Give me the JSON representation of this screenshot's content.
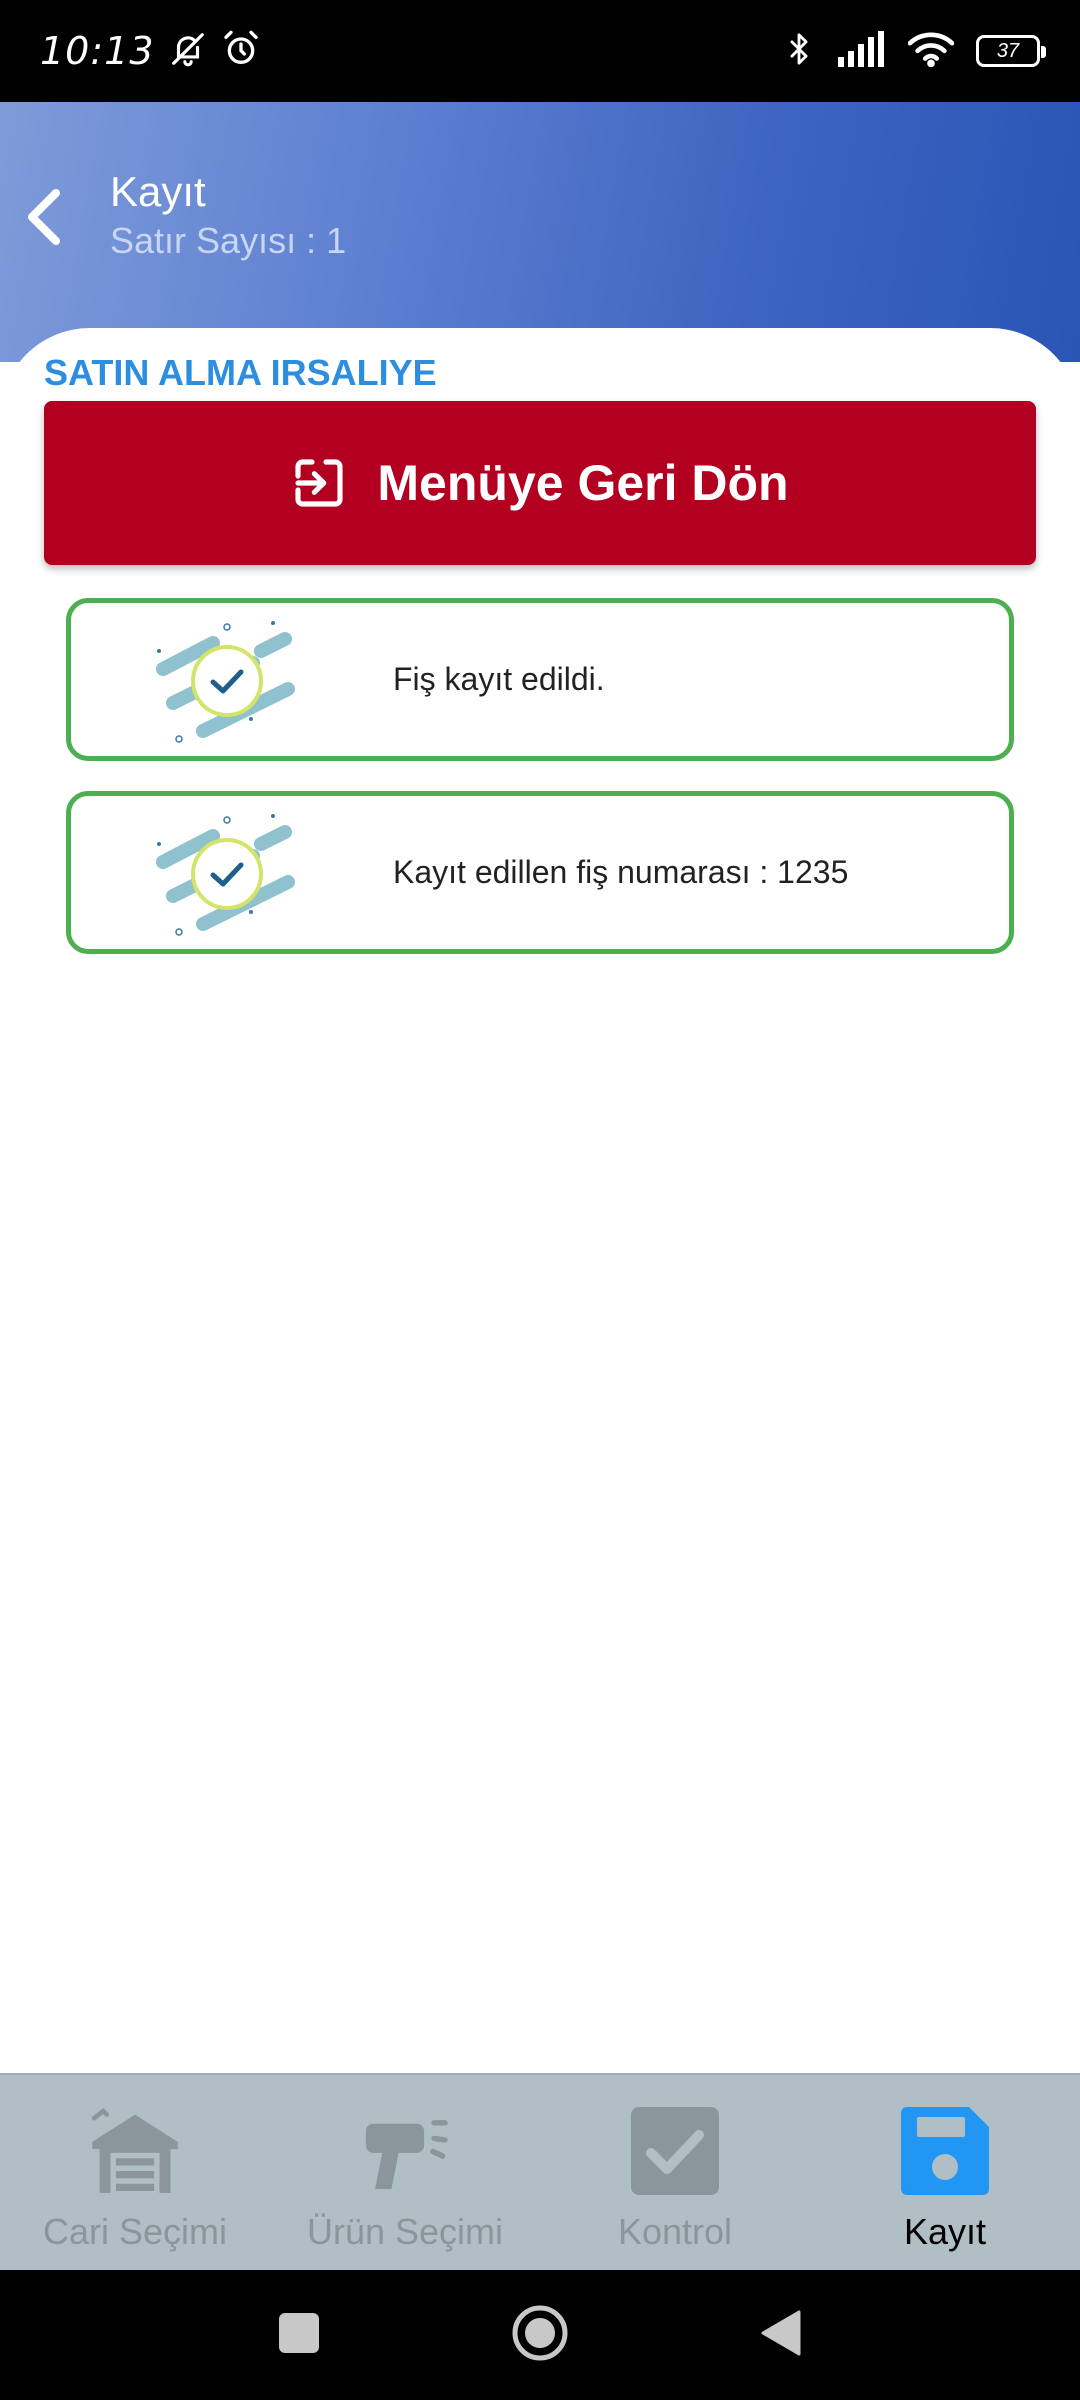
{
  "status_bar": {
    "time": "10:13",
    "battery": "37",
    "icons": [
      "bell-off-icon",
      "alarm-icon",
      "bluetooth-icon",
      "signal-icon",
      "wifi-icon",
      "battery-icon"
    ]
  },
  "header": {
    "title": "Kayıt",
    "subtitle": "Satır Sayısı : 1"
  },
  "section_title": "SATIN ALMA IRSALIYE",
  "menu_button_label": "Menüye Geri Dön",
  "messages": [
    {
      "text": "Fiş kayıt edildi."
    },
    {
      "text": "Kayıt edillen fiş numarası : 1235"
    }
  ],
  "bottom_nav": [
    {
      "label": "Cari Seçimi",
      "icon": "warehouse-icon",
      "active": false
    },
    {
      "label": "Ürün Seçimi",
      "icon": "barcode-scanner-icon",
      "active": false
    },
    {
      "label": "Kontrol",
      "icon": "checkbox-icon",
      "active": false
    },
    {
      "label": "Kayıt",
      "icon": "save-icon",
      "active": true
    }
  ],
  "colors": {
    "header_gradient_start": "#7e9bd9",
    "header_gradient_end": "#2a55b6",
    "section_title": "#2d8ee0",
    "menu_button": "#b30020",
    "card_border": "#4caf50",
    "nav_background": "#b0bec5",
    "nav_inactive": "#8a969c",
    "nav_active_icon": "#2196f3"
  }
}
